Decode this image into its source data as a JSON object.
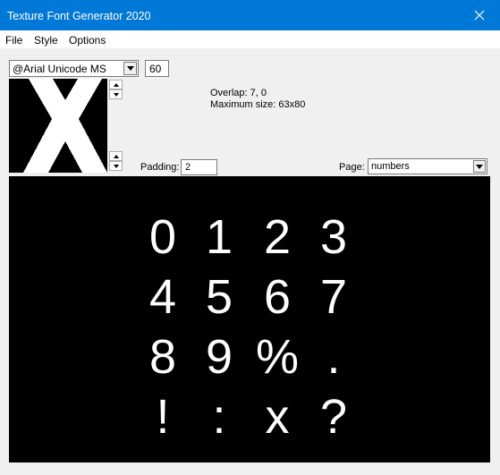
{
  "window": {
    "title": "Texture Font Generator 2020",
    "close_glyph": "✕"
  },
  "menu": {
    "items": [
      "File",
      "Style",
      "Options"
    ]
  },
  "controls": {
    "font_name": "@Arial Unicode MS",
    "font_size": "60",
    "preview_glyph": "X",
    "overlap": "Overlap: 7, 0",
    "max_size": "Maximum size: 63x80",
    "padding_label": "Padding:",
    "padding_value": "2",
    "page_label": "Page:",
    "page_value": "numbers"
  },
  "glyphs": [
    "0",
    "1",
    "2",
    "3",
    "4",
    "5",
    "6",
    "7",
    "8",
    "9",
    "%",
    ".",
    "!",
    ":",
    "x",
    "?"
  ],
  "colors": {
    "titlebar": "#0078d7",
    "client_bg": "#f0f0f0",
    "canvas_bg": "#000000",
    "glyph": "#ffffff"
  }
}
